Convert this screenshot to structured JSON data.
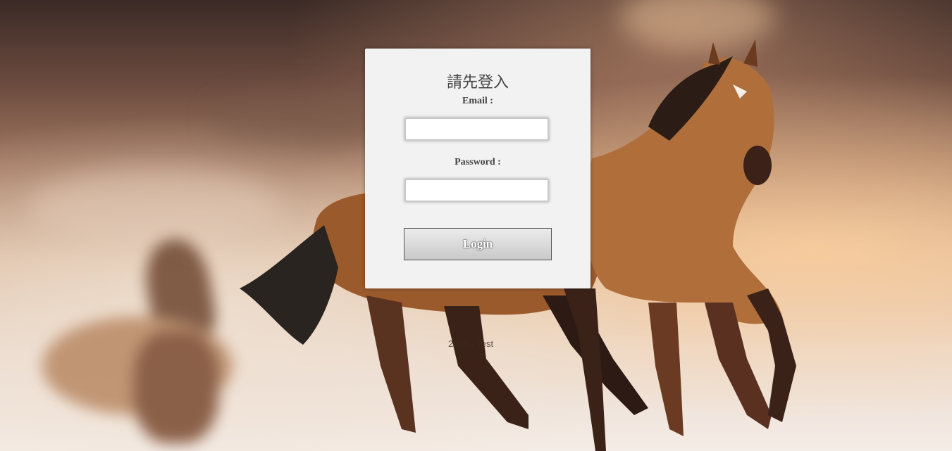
{
  "login": {
    "title": "請先登入",
    "email_label": "Email :",
    "email_value": "",
    "password_label": "Password :",
    "password_value": "",
    "login_button_label": "Login"
  },
  "footer": {
    "copyright_text": "2016 - Test"
  },
  "colors": {
    "panel_background": "#f2f2f2",
    "button_border": "#555555",
    "label_text": "#444444"
  }
}
